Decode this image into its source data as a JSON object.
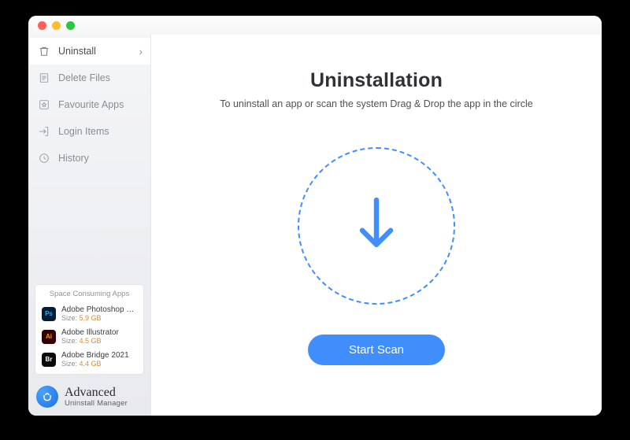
{
  "sidebar": {
    "items": [
      {
        "label": "Uninstall",
        "icon": "trash-icon",
        "active": true,
        "chevron": true
      },
      {
        "label": "Delete Files",
        "icon": "files-icon",
        "active": false,
        "chevron": false
      },
      {
        "label": "Favourite Apps",
        "icon": "star-box-icon",
        "active": false,
        "chevron": false
      },
      {
        "label": "Login Items",
        "icon": "login-icon",
        "active": false,
        "chevron": false
      },
      {
        "label": "History",
        "icon": "clock-icon",
        "active": false,
        "chevron": false
      }
    ]
  },
  "spaceCard": {
    "title": "Space Consuming Apps",
    "apps": [
      {
        "name": "Adobe Photoshop 2…",
        "sizeLabel": "Size: ",
        "size": "5.9 GB",
        "badge": "Ps",
        "bg": "#001d34",
        "fg": "#31a8ff"
      },
      {
        "name": "Adobe Illustrator",
        "sizeLabel": "Size: ",
        "size": "4.5 GB",
        "badge": "Ai",
        "bg": "#310000",
        "fg": "#ff9a00"
      },
      {
        "name": "Adobe Bridge 2021",
        "sizeLabel": "Size: ",
        "size": "4.4 GB",
        "badge": "Br",
        "bg": "#0a0a0a",
        "fg": "#ffffff"
      }
    ]
  },
  "brand": {
    "name": "Advanced",
    "tagline": "Uninstall Manager"
  },
  "main": {
    "title": "Uninstallation",
    "subtitle": "To uninstall an app or scan the system Drag & Drop the app in the circle",
    "scanLabel": "Start Scan"
  },
  "colors": {
    "accent": "#3f8efc"
  }
}
